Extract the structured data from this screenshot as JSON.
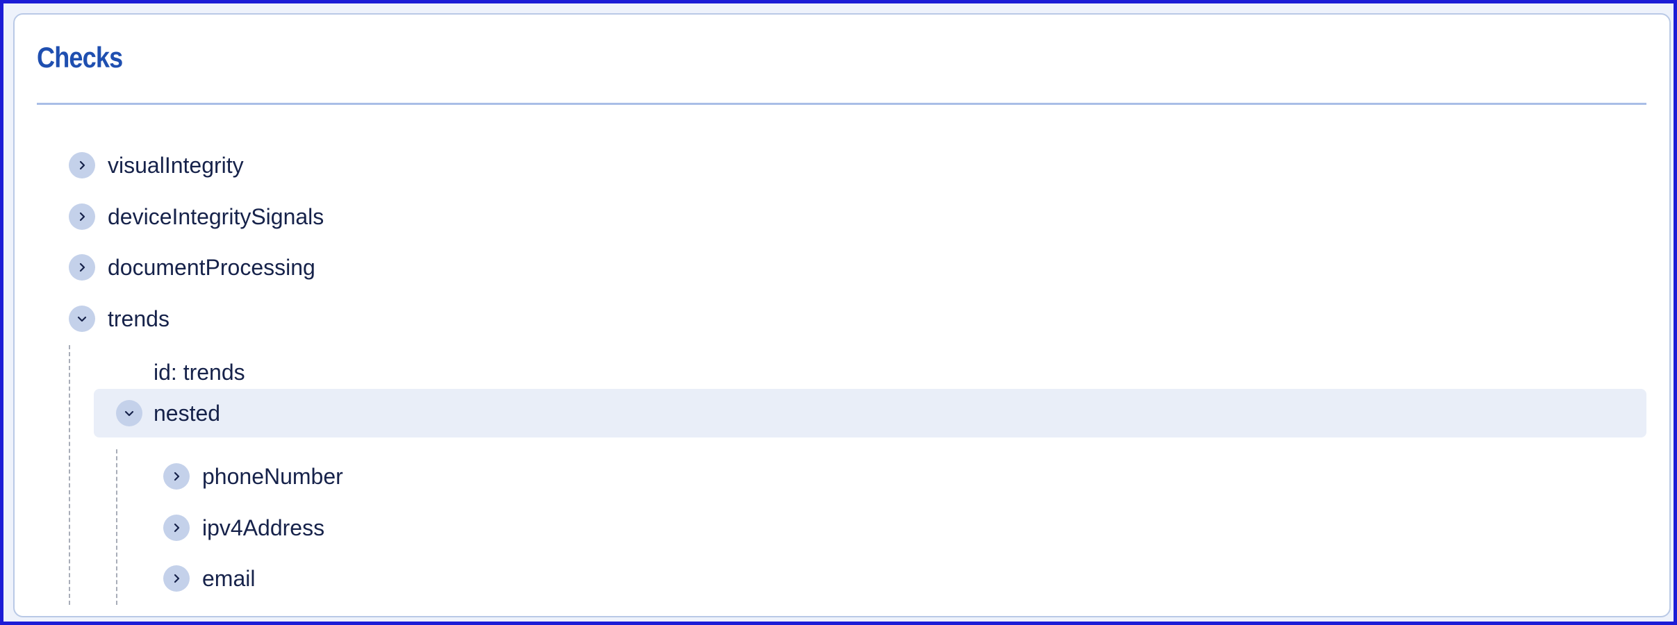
{
  "panel": {
    "title": "Checks"
  },
  "tree": {
    "items": [
      {
        "label": "visualIntegrity",
        "expanded": false,
        "icon": "chevron-right-icon"
      },
      {
        "label": "deviceIntegritySignals",
        "expanded": false,
        "icon": "chevron-right-icon"
      },
      {
        "label": "documentProcessing",
        "expanded": false,
        "icon": "chevron-right-icon"
      },
      {
        "label": "trends",
        "expanded": true,
        "icon": "chevron-down-icon"
      }
    ],
    "trends_children": {
      "id_text": "id: trends",
      "nested": {
        "label": "nested",
        "expanded": true,
        "icon": "chevron-down-icon",
        "children": [
          {
            "label": "phoneNumber",
            "expanded": false,
            "icon": "chevron-right-icon"
          },
          {
            "label": "ipv4Address",
            "expanded": false,
            "icon": "chevron-right-icon"
          },
          {
            "label": "email",
            "expanded": false,
            "icon": "chevron-right-icon"
          }
        ]
      }
    }
  },
  "colors": {
    "title": "#1f4fb0",
    "text": "#16224a",
    "toggle_bg": "#c4d1ea",
    "highlight_bg": "#e9eef8",
    "page_border": "#1c1cd6"
  }
}
